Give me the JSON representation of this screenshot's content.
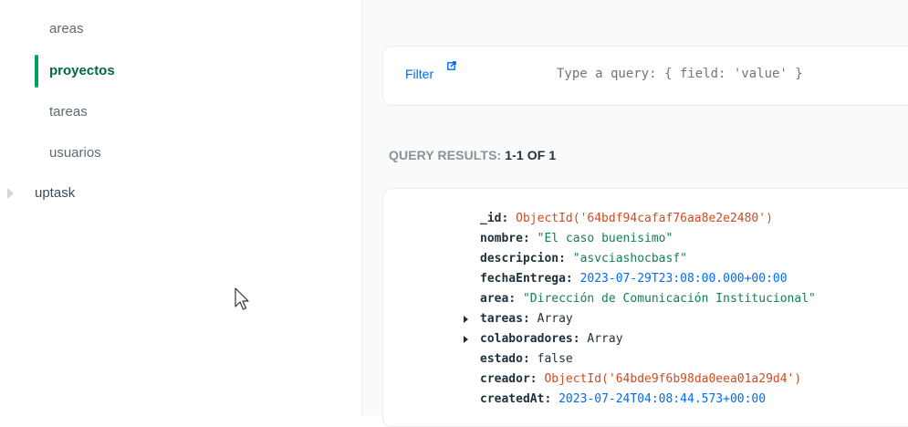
{
  "sidebar": {
    "collections": [
      {
        "label": "areas"
      },
      {
        "label": "proyectos"
      },
      {
        "label": "tareas"
      },
      {
        "label": "usuarios"
      }
    ],
    "database": "uptask"
  },
  "filter": {
    "label": "Filter",
    "placeholder": "Type a query: { field: 'value' }"
  },
  "results": {
    "label": "QUERY RESULTS:",
    "count": "1-1 OF 1"
  },
  "document": {
    "fields": [
      {
        "key": "_id",
        "value": "ObjectId('64bdf94cafaf76aa8e2e2480')"
      },
      {
        "key": "nombre",
        "value": "\"El caso buenisimo\""
      },
      {
        "key": "descripcion",
        "value": "\"asvciashocbasf\""
      },
      {
        "key": "fechaEntrega",
        "value": "2023-07-29T23:08:00.000+00:00"
      },
      {
        "key": "area",
        "value": "\"Dirección de Comunicación Institucional\""
      },
      {
        "key": "tareas",
        "value": "Array"
      },
      {
        "key": "colaboradores",
        "value": "Array"
      },
      {
        "key": "estado",
        "value": "false"
      },
      {
        "key": "creador",
        "value": "ObjectId('64bde9f6b98da0eea01a29d4')"
      },
      {
        "key": "createdAt",
        "value": "2023-07-24T04:08:44.573+00:00"
      }
    ]
  },
  "colors": {
    "accent_green": "#00a35c",
    "link_blue": "#016bf8",
    "objectid": "#cf4a22",
    "string": "#12824d"
  }
}
